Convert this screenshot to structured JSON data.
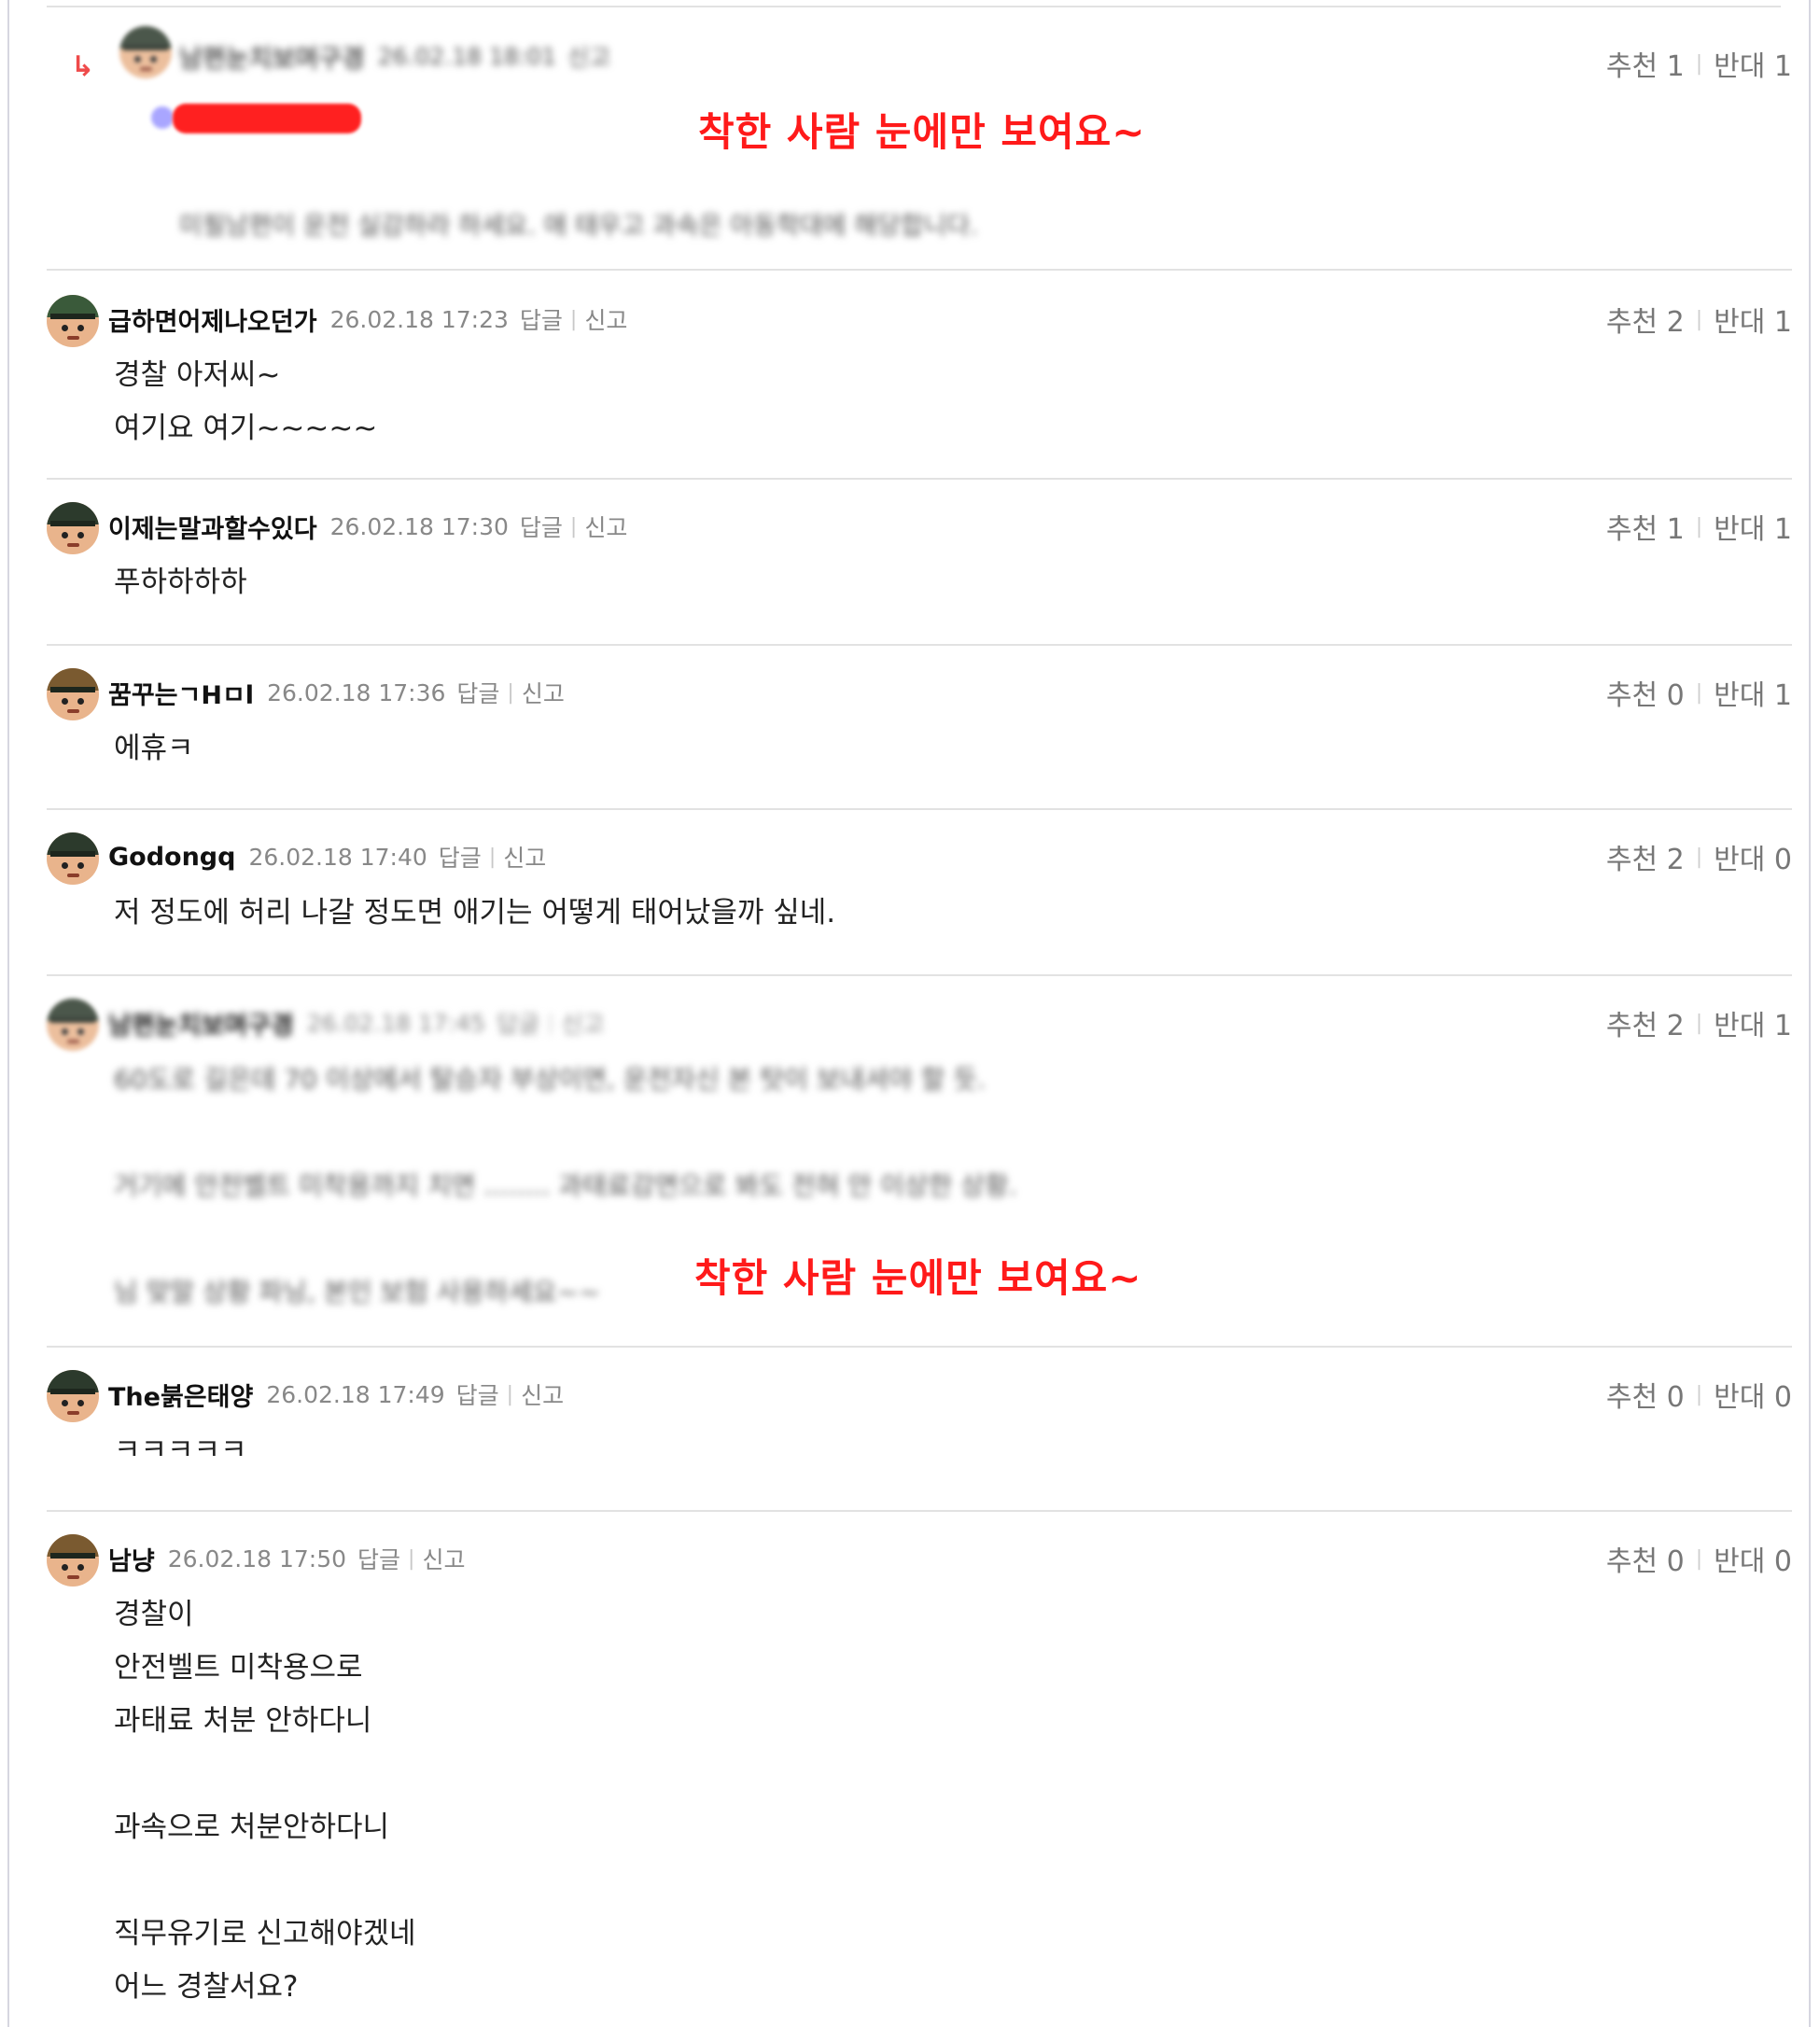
{
  "overlay_text": "착한 사람 눈에만 보여요~",
  "labels": {
    "reply": "답글",
    "report": "신고",
    "up": "추천",
    "down": "반대"
  },
  "blurred_reply": {
    "nick": "남편눈치보며구경",
    "date": "26.02.18 18:01",
    "report": "신고",
    "up": 1,
    "down": 1,
    "text": "미필남편이 운전 실감하라 하세요. 애 태우고 과속은 아동학대에 해당합니다."
  },
  "comments": [
    {
      "nick": "급하면어제나오던가",
      "date": "26.02.18 17:23",
      "up": 2,
      "down": 1,
      "lines": [
        "경찰 아저씨~",
        "여기요 여기~~~~~"
      ]
    },
    {
      "nick": "이제는말과할수있다",
      "date": "26.02.18 17:30",
      "up": 1,
      "down": 1,
      "lines": [
        "푸하하하하"
      ]
    },
    {
      "nick": "꿈꾸는ㄱHㅁl",
      "date": "26.02.18 17:36",
      "up": 0,
      "down": 1,
      "lines": [
        "에휴ㅋ"
      ]
    },
    {
      "nick": "Godongq",
      "date": "26.02.18 17:40",
      "up": 2,
      "down": 0,
      "lines": [
        "저 정도에 허리 나갈 정도면 애기는 어떻게 태어났을까 싶네."
      ]
    },
    {
      "nick": "남편눈치보며구경",
      "date": "26.02.18 17:45",
      "up": 2,
      "down": 1,
      "lines": [
        "60도로 길은데 70 이상에서 탈승자 부상이면, 운전자신 본 탓이 보내셔야 할 듯.",
        "",
        "거기에 안전벨트 미착용까지 치면 ........ 과태료감면으로 봐도 전혀 안 이상한 상황.",
        "",
        "님 맞말 상황 파닝, 본인 보험 사용하세요~~"
      ]
    },
    {
      "nick": "The붉은태양",
      "date": "26.02.18 17:49",
      "up": 0,
      "down": 0,
      "lines": [
        "ㅋㅋㅋㅋㅋ"
      ]
    },
    {
      "nick": "남냥",
      "date": "26.02.18 17:50",
      "up": 0,
      "down": 0,
      "lines": [
        "경찰이",
        "안전벨트 미착용으로",
        "과태료 처분 안하다니",
        "",
        "과속으로 처분안하다니",
        "",
        "직무유기로 신고해야겠네",
        "어느 경찰서요?"
      ]
    }
  ]
}
